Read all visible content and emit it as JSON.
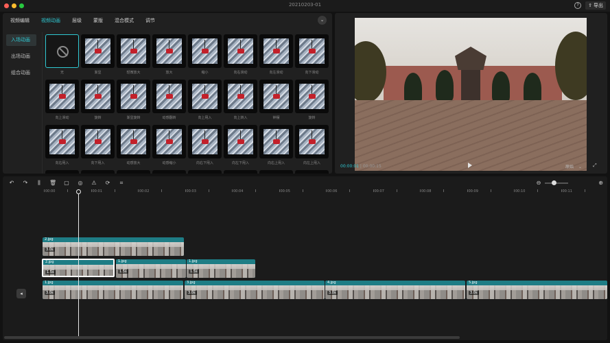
{
  "window": {
    "title": "20210203-01",
    "traffic_colors": [
      "#ff5f57",
      "#febc2e",
      "#28c840"
    ],
    "help_icon": "?",
    "export_label": "导出",
    "export_icon": "⇪"
  },
  "top_tabs": [
    "视频编辑",
    "视频动画",
    "层级",
    "蒙版",
    "混合模式",
    "调节"
  ],
  "collapse_icon": "⌄",
  "side_nav": [
    "入场动画",
    "出场动画",
    "组合动画"
  ],
  "animations": [
    "无",
    "渐显",
    "轻微放大",
    "放大",
    "缩小",
    "向右滑动",
    "向左滑动",
    "向下滑动",
    "向上滑动",
    "旋转",
    "渐显旋转",
    "动感翻转",
    "向上甩入",
    "向上转入",
    "钟摆",
    "旋转",
    "向右甩入",
    "向下甩入",
    "动感放大",
    "动感缩小",
    "向右下甩入",
    "向左下甩入",
    "向右上甩入",
    "向左上甩入",
    "",
    "",
    "",
    "",
    "",
    "",
    "",
    ""
  ],
  "preview": {
    "current_time": "00:00:01",
    "total_time": "00:00:15",
    "ratio_label": "原始",
    "ratio_chevron": "⌄",
    "fullscreen_icon": "⤢"
  },
  "timeline": {
    "tool_icons": [
      "↶",
      "↷",
      "⫼",
      "🗑",
      "▢",
      "◎",
      "⚠",
      "⟳",
      "⌗"
    ],
    "ruler": [
      "00:00",
      "00:01",
      "00:02",
      "00:03",
      "00:04",
      "00:05",
      "00:06",
      "00:07",
      "00:08",
      "00:09",
      "00:10",
      "00:11"
    ],
    "track_toggle_icon": "◂",
    "zoom_out_icon": "⊖",
    "zoom_in_icon": "⊕",
    "clips": [
      {
        "name": "2.jpg",
        "speed": "3.0s"
      },
      {
        "name": "2.jpg",
        "speed": "1.5s"
      },
      {
        "name": "1.jpg",
        "speed": "1.5s"
      },
      {
        "name": "1.jpg",
        "speed": "1.5s"
      },
      {
        "name": "1.jpg",
        "speed": "3.0s"
      },
      {
        "name": "3.jpg",
        "speed": "3.0s"
      },
      {
        "name": "4.jpg",
        "speed": "3.0s"
      },
      {
        "name": "5.jpg",
        "speed": "3.0s"
      }
    ]
  }
}
